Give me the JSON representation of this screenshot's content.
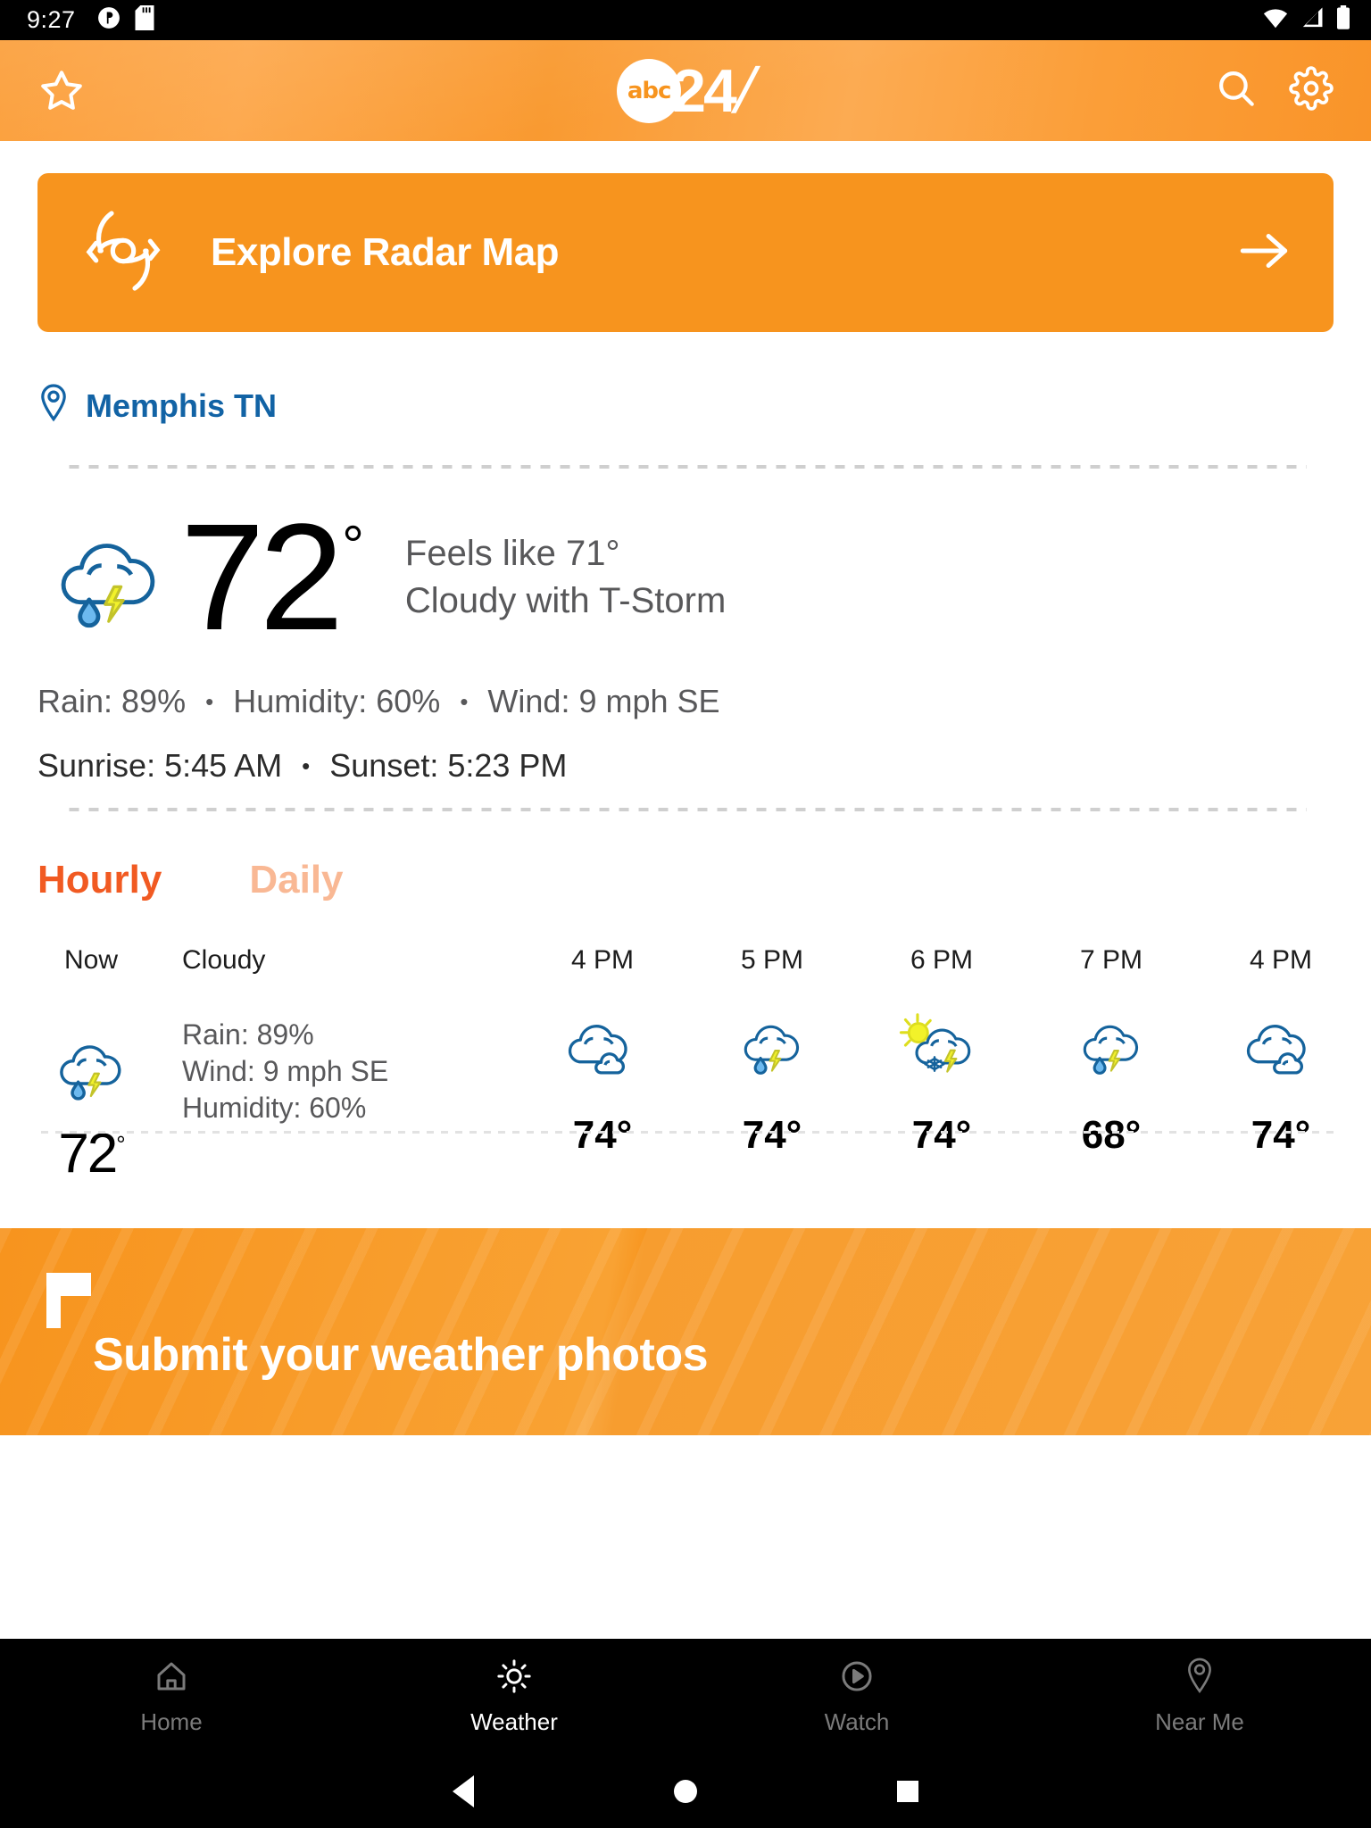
{
  "status_bar": {
    "time": "9:27",
    "left_icons": [
      "notification-icon",
      "sd-card-icon"
    ],
    "right_icons": [
      "wifi-icon",
      "cell-signal-icon",
      "battery-icon"
    ]
  },
  "app_bar": {
    "favorite_icon": "star-icon",
    "logo_abc": "abc",
    "logo_num": "24",
    "logo_slash": "/",
    "search_icon": "search-icon",
    "settings_icon": "gear-icon",
    "background_color": "#f7941e"
  },
  "radar_banner": {
    "icon": "radar-hurricane-icon",
    "label": "Explore Radar Map",
    "arrow_icon": "arrow-right-icon",
    "color": "#f7941e"
  },
  "location": {
    "pin_icon": "location-pin-icon",
    "name": "Memphis TN",
    "color": "#1263a5"
  },
  "current": {
    "icon": "cloud-rain-thunder-icon",
    "temperature": "72",
    "degree": "°",
    "feels_like": "Feels like 71°",
    "condition": "Cloudy with T-Storm",
    "rain": "Rain: 89%",
    "humidity": "Humidity: 60%",
    "wind": "Wind: 9 mph SE",
    "sunrise": "Sunrise: 5:45 AM",
    "sunset": "Sunset: 5:23 PM",
    "bullet": "•"
  },
  "tabs": {
    "hourly": "Hourly",
    "daily": "Daily",
    "active": "Hourly",
    "active_color": "#f15a22",
    "inactive_color": "#f9b894"
  },
  "now_block": {
    "label": "Now",
    "condition": "Cloudy",
    "icon": "cloud-rain-thunder-icon",
    "temperature": "72",
    "degree": "°",
    "rain": "Rain: 89%",
    "wind": "Wind: 9 mph SE",
    "humidity": "Humidity: 60%"
  },
  "hourly_forecast": [
    {
      "time": "4 PM",
      "icon": "cloudy-icon",
      "temp": "74°"
    },
    {
      "time": "5 PM",
      "icon": "cloud-rain-thunder-icon",
      "temp": "74°"
    },
    {
      "time": "6 PM",
      "icon": "sun-cloud-snow-thunder-icon",
      "temp": "74°"
    },
    {
      "time": "7 PM",
      "icon": "cloud-rain-thunder-icon",
      "temp": "68°"
    },
    {
      "time": "4 PM",
      "icon": "cloudy-icon",
      "temp": "74°"
    }
  ],
  "promo": {
    "mark_icon": "corner-bracket-icon",
    "text": "Submit your weather photos",
    "color": "#f7941e"
  },
  "bottom_nav": {
    "items": [
      {
        "label": "Home",
        "icon": "home-icon",
        "active": false
      },
      {
        "label": "Weather",
        "icon": "sun-icon",
        "active": true
      },
      {
        "label": "Watch",
        "icon": "play-icon",
        "active": false
      },
      {
        "label": "Near Me",
        "icon": "location-pin-icon",
        "active": false
      }
    ]
  },
  "system_nav": {
    "back_icon": "triangle-back-icon",
    "home_icon": "circle-home-icon",
    "recents_icon": "square-recents-icon"
  }
}
